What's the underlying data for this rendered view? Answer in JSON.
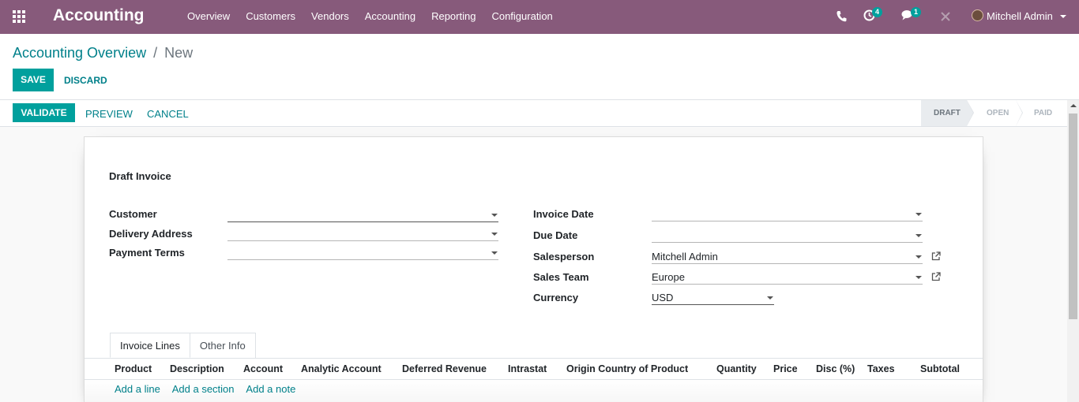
{
  "navbar": {
    "brand": "Accounting",
    "menu": [
      "Overview",
      "Customers",
      "Vendors",
      "Accounting",
      "Reporting",
      "Configuration"
    ],
    "activity_badge": "4",
    "messages_badge": "1",
    "user_name": "Mitchell Admin"
  },
  "breadcrumb": {
    "parent": "Accounting Overview",
    "separator": "/",
    "current": "New"
  },
  "buttons": {
    "save": "Save",
    "discard": "Discard",
    "validate": "Validate",
    "preview": "Preview",
    "cancel": "Cancel"
  },
  "stages": [
    "Draft",
    "Open",
    "Paid"
  ],
  "form": {
    "title": "Draft Invoice",
    "left_fields": [
      {
        "label": "Customer",
        "value": ""
      },
      {
        "label": "Delivery Address",
        "value": ""
      },
      {
        "label": "Payment Terms",
        "value": ""
      }
    ],
    "right_fields": [
      {
        "label": "Invoice Date",
        "value": ""
      },
      {
        "label": "Due Date",
        "value": ""
      },
      {
        "label": "Salesperson",
        "value": "Mitchell Admin"
      },
      {
        "label": "Sales Team",
        "value": "Europe"
      },
      {
        "label": "Currency",
        "value": "USD"
      }
    ]
  },
  "tabs": [
    "Invoice Lines",
    "Other Info"
  ],
  "table": {
    "columns": [
      "Product",
      "Description",
      "Account",
      "Analytic Account",
      "Deferred Revenue",
      "Intrastat",
      "Origin Country of Product",
      "Quantity",
      "Price",
      "Disc (%)",
      "Taxes",
      "Subtotal"
    ],
    "add_links": [
      "Add a line",
      "Add a section",
      "Add a note"
    ]
  },
  "colors": {
    "navbar": "#875a7b",
    "primary": "#00a09d",
    "link": "#00808a"
  }
}
